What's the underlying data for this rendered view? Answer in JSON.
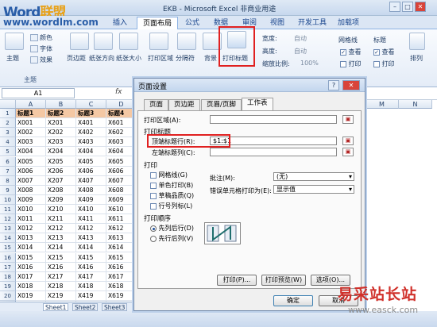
{
  "watermark": {
    "brand_word": "Word",
    "brand_cn": "联盟",
    "url": "www.wordlm.com",
    "site_cn": "易采站长站",
    "site_url": "www.easck.com"
  },
  "window": {
    "title": "EKB - Microsoft Excel 非商业用途",
    "min": "–",
    "max": "□",
    "close": "✕"
  },
  "ribbon_tabs": [
    "插入",
    "页面布局",
    "公式",
    "数据",
    "审阅",
    "视图",
    "开发工具",
    "加载项"
  ],
  "ribbon": {
    "theme_label": "主题",
    "colors": "颜色",
    "fonts": "字体",
    "effects": "效果",
    "theme_group": "主题",
    "buttons": [
      "页边距",
      "纸张方向",
      "纸张大小",
      "打印区域",
      "分隔符",
      "背景",
      "打印标题"
    ],
    "width_label": "宽度:",
    "height_label": "高度:",
    "scale_label": "缩放比例:",
    "auto": "自动",
    "scale_value": "100%",
    "gridlines": "网格线",
    "headings": "标题",
    "view": "查看",
    "print": "打印",
    "arrange": "排列"
  },
  "formula": {
    "name_box": "A1",
    "fx": "fx"
  },
  "sheet": {
    "columns": [
      "A",
      "B",
      "C",
      "D"
    ],
    "header_row": [
      "标题1",
      "标题2",
      "标题3",
      "标题4"
    ],
    "rows": [
      [
        "X001",
        "X201",
        "X401",
        "X601"
      ],
      [
        "X002",
        "X202",
        "X402",
        "X602"
      ],
      [
        "X003",
        "X203",
        "X403",
        "X603"
      ],
      [
        "X004",
        "X204",
        "X404",
        "X604"
      ],
      [
        "X005",
        "X205",
        "X405",
        "X605"
      ],
      [
        "X006",
        "X206",
        "X406",
        "X606"
      ],
      [
        "X007",
        "X207",
        "X407",
        "X607"
      ],
      [
        "X008",
        "X208",
        "X408",
        "X608"
      ],
      [
        "X009",
        "X209",
        "X409",
        "X609"
      ],
      [
        "X010",
        "X210",
        "X410",
        "X610"
      ],
      [
        "X011",
        "X211",
        "X411",
        "X611"
      ],
      [
        "X012",
        "X212",
        "X412",
        "X612"
      ],
      [
        "X013",
        "X213",
        "X413",
        "X613"
      ],
      [
        "X014",
        "X214",
        "X414",
        "X614"
      ],
      [
        "X015",
        "X215",
        "X415",
        "X615"
      ],
      [
        "X016",
        "X216",
        "X416",
        "X616"
      ],
      [
        "X017",
        "X217",
        "X417",
        "X617"
      ],
      [
        "X018",
        "X218",
        "X418",
        "X618"
      ],
      [
        "X019",
        "X219",
        "X419",
        "X619"
      ],
      [
        "X020",
        "X220",
        "X420",
        "X620"
      ]
    ],
    "right_cols": [
      "M",
      "N"
    ],
    "tabs": [
      "Sheet1",
      "Sheet2",
      "Sheet3"
    ]
  },
  "dialog": {
    "title": "页面设置",
    "help": "?",
    "close": "✕",
    "tabs": [
      "页面",
      "页边距",
      "页眉/页脚",
      "工作表"
    ],
    "print_area_label": "打印区域(A):",
    "print_titles_label": "打印标题",
    "top_rows_label": "顶端标题行(R):",
    "top_rows_value": "$1:$1",
    "left_cols_label": "左端标题列(C):",
    "print_label": "打印",
    "gridlines": "网格线(G)",
    "mono": "单色打印(B)",
    "draft": "草稿品质(Q)",
    "rowcol": "行号列标(L)",
    "comments_label": "批注(M):",
    "comments_value": "(无)",
    "errors_label": "错误单元格打印为(E):",
    "errors_value": "显示值",
    "order_label": "打印顺序",
    "down_then_over": "先列后行(D)",
    "over_then_down": "先行后列(V)",
    "print_btn": "打印(P)...",
    "preview_btn": "打印预览(W)",
    "options_btn": "选项(O)...",
    "ok": "确定",
    "cancel": "取消"
  }
}
